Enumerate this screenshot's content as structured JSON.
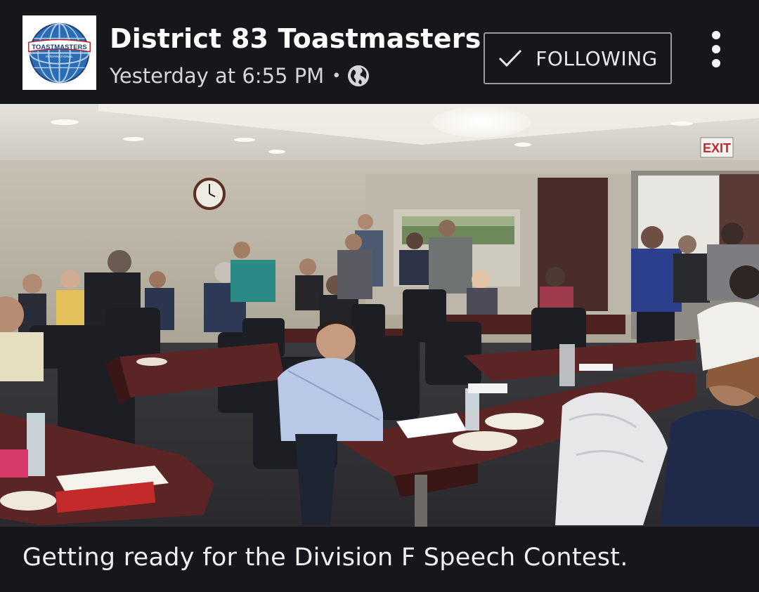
{
  "post": {
    "page_name": "District 83 Toastmasters",
    "timestamp": "Yesterday at 6:55 PM",
    "separator": "•",
    "privacy_icon": "globe-icon",
    "follow_button": {
      "label": "FOLLOWING",
      "icon": "check-icon"
    },
    "more_icon": "more-vertical-icon",
    "caption": "Getting ready for the Division F Speech Contest."
  },
  "avatar_logo": {
    "top_text": "TOASTMASTERS",
    "bottom_text": "INTERNATIONAL"
  },
  "photo_scene": {
    "exit_sign": "EXIT"
  },
  "colors": {
    "background": "#16171b",
    "text_primary": "#ffffff",
    "text_secondary": "#d6d6d6",
    "button_border": "#9a9a9a",
    "logo_blue": "#1d5fa6",
    "logo_red": "#b5202a"
  }
}
